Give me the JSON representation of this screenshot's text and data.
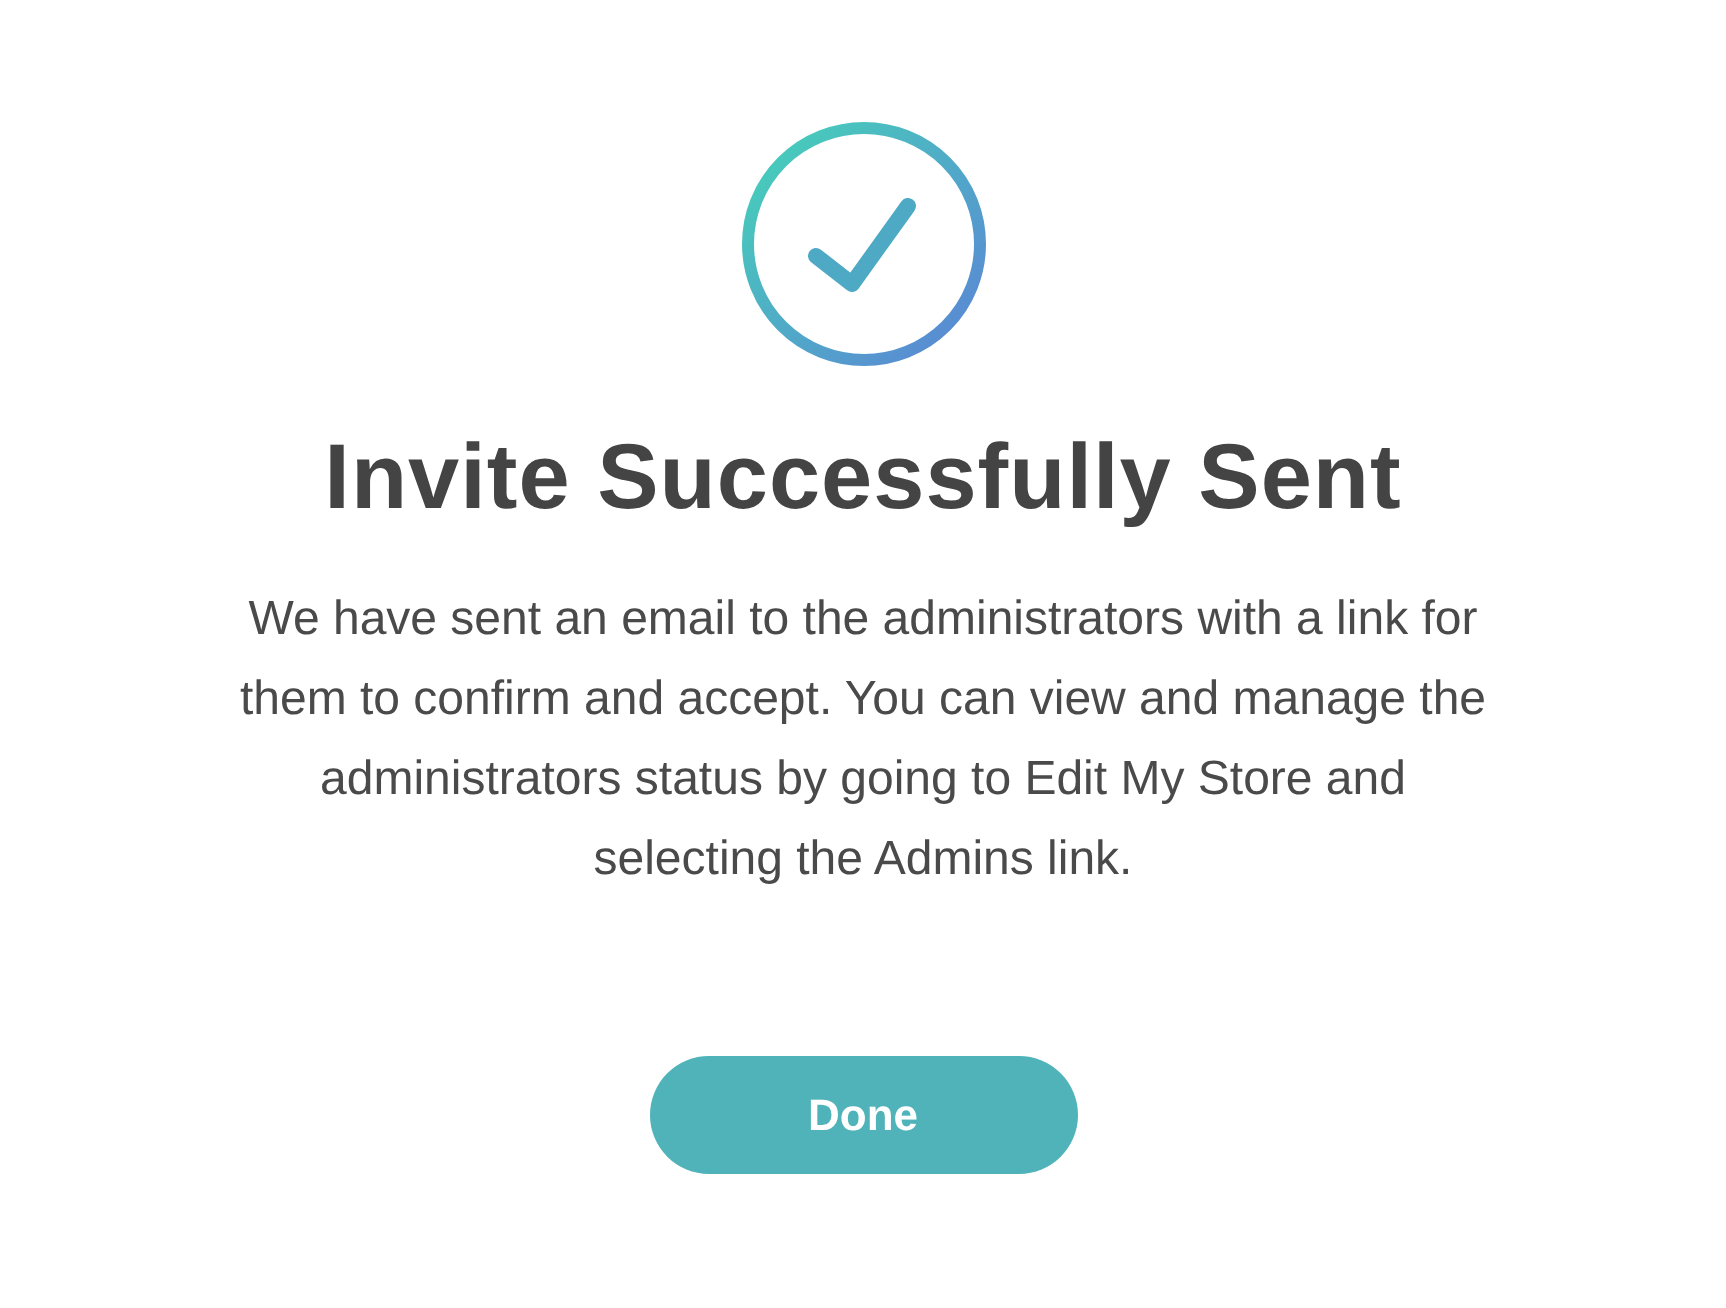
{
  "title": "Invite Successfully Sent",
  "message": "We have sent an email to the administrators with a link for them to confirm and accept. You can view and manage the administrators status by going to Edit My Store and selecting the Admins link.",
  "button": "Done"
}
